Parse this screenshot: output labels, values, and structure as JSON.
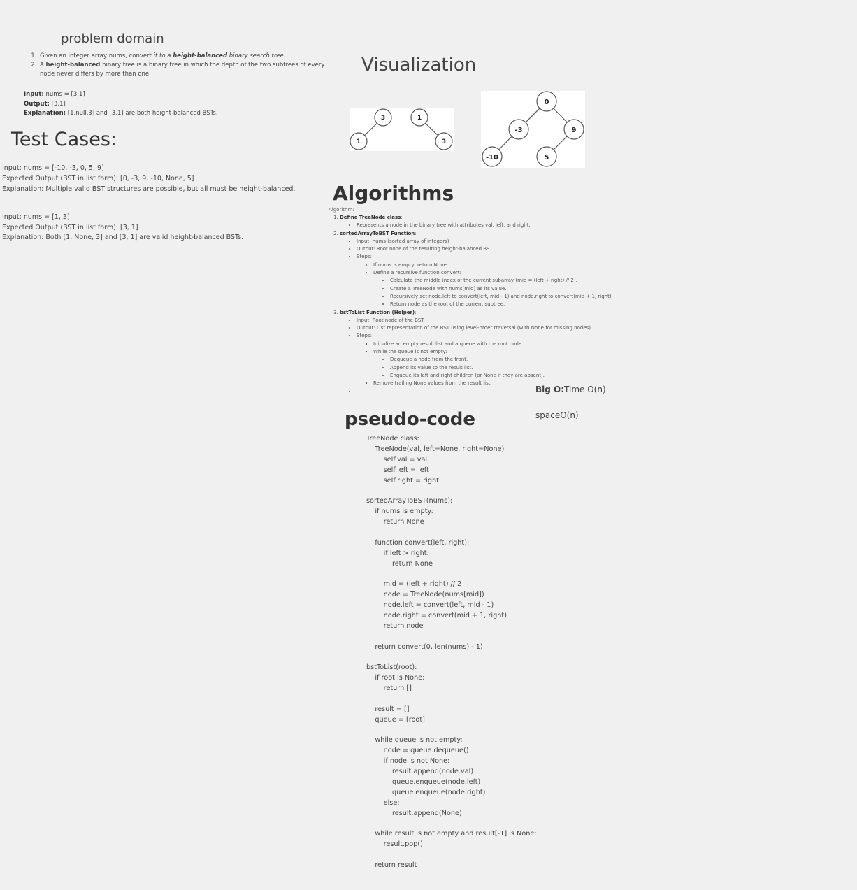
{
  "problem_domain": {
    "title": "problem domain",
    "item1": {
      "pre": "Given an integer array nums, convert ",
      "em": "it to a ",
      "bold": "height-balanced",
      "post": " binary search tree."
    },
    "item2": {
      "pre": "A ",
      "bold": "height-balanced",
      "post": " binary tree is a binary tree in which the depth of the two subtrees of every node never differs by more than one."
    },
    "input_label": "Input:",
    "input_value": "nums = [3,1]",
    "output_label": "Output:",
    "output_value": "[3,1]",
    "explanation_label": "Explanation:",
    "explanation_value": "[1,null,3] and [3,1] are both height-balanced BSTs."
  },
  "test_cases": {
    "title": "Test Cases:",
    "case1": {
      "input": "Input: nums = [-10, -3, 0, 5, 9]",
      "output": "Expected Output (BST in list form): [0, -3, 9, -10, None, 5]",
      "explanation": "Explanation: Multiple valid BST structures are possible, but all must be height-balanced."
    },
    "case2": {
      "input": "Input: nums = [1, 3]",
      "output": "Expected Output (BST in list form): [3, 1]",
      "explanation": "Explanation: Both [1, None, 3] and [3, 1] are valid height-balanced BSTs."
    }
  },
  "visualization": {
    "title": "Visualization",
    "small_tree_a": {
      "root": "3",
      "left": "1"
    },
    "small_tree_b": {
      "root": "1",
      "right": "3"
    },
    "big_tree": {
      "root": "0",
      "l": "-3",
      "r": "9",
      "ll": "-10",
      "rl": "5"
    }
  },
  "algorithms": {
    "title": "Algorithms",
    "label": "Algorithm:",
    "s1_title": "Define TreeNode class",
    "s1_b1": "Represents a node in the binary tree with attributes val, left, and right.",
    "s2_title": "sortedArrayToBST Function",
    "s2_b1": "Input: nums (sorted array of integers)",
    "s2_b2": "Output: Root node of the resulting height-balanced BST",
    "s2_b3": "Steps:",
    "s2_b3_1": "If nums is empty, return None.",
    "s2_b3_2": "Define a recursive function convert:",
    "s2_b3_2_1": "Calculate the middle index of the current subarray (mid = (left + right) // 2).",
    "s2_b3_2_2": "Create a TreeNode with nums[mid] as its value.",
    "s2_b3_2_3": "Recursively set node.left to convert(left, mid - 1) and node.right to convert(mid + 1, right).",
    "s2_b3_2_4": "Return node as the root of the current subtree.",
    "s3_title": "bstToList Function (Helper)",
    "s3_b1": "Input: Root node of the BST",
    "s3_b2": "Output: List representation of the BST using level-order traversal (with None for missing nodes).",
    "s3_b3": "Steps:",
    "s3_b3_1": "Initialize an empty result list and a queue with the root node.",
    "s3_b3_2": "While the queue is not empty:",
    "s3_b3_2_1": "Dequeue a node from the front.",
    "s3_b3_2_2": "Append its value to the result list.",
    "s3_b3_2_3": "Enqueue its left and right children (or None if they are absent).",
    "s3_b3_3": "Remove trailing None values from the result list."
  },
  "big_o": {
    "label": "Big O:",
    "time": "Time O(n)",
    "space": "spaceO(n)"
  },
  "pseudo_code": {
    "title": "pseudo-code",
    "code": "TreeNode class:\n    TreeNode(val, left=None, right=None)\n        self.val = val\n        self.left = left\n        self.right = right\n\nsortedArrayToBST(nums):\n    if nums is empty:\n        return None\n\n    function convert(left, right):\n        if left > right:\n            return None\n\n        mid = (left + right) // 2\n        node = TreeNode(nums[mid])\n        node.left = convert(left, mid - 1)\n        node.right = convert(mid + 1, right)\n        return node\n\n    return convert(0, len(nums) - 1)\n\nbstToList(root):\n    if root is None:\n        return []\n\n    result = []\n    queue = [root]\n\n    while queue is not empty:\n        node = queue.dequeue()\n        if node is not None:\n            result.append(node.val)\n            queue.enqueue(node.left)\n            queue.enqueue(node.right)\n        else:\n            result.append(None)\n\n    while result is not empty and result[-1] is None:\n        result.pop()\n\n    return result"
  }
}
